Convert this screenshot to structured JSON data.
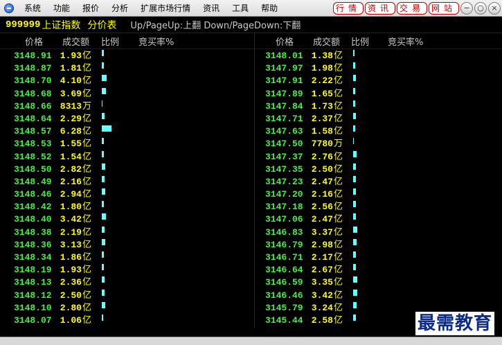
{
  "menu": {
    "items": [
      "系统",
      "功能",
      "报价",
      "分析",
      "扩展市场行情",
      "资讯",
      "工具",
      "帮助"
    ],
    "quick_buttons": [
      "行情",
      "资讯",
      "交易",
      "网站"
    ]
  },
  "header": {
    "code": "999999",
    "name": "上证指数",
    "mode": "分价表",
    "hint": "Up/PageUp:上翻 Down/PageDown:下翻"
  },
  "columns": {
    "price": "价格",
    "volume": "成交额",
    "ratio": "比例",
    "buy_rate": "竞买率%"
  },
  "left_rows": [
    {
      "price": "3148.91",
      "vol": "1.93",
      "unit": "亿",
      "ratio": 0.23
    },
    {
      "price": "3148.87",
      "vol": "1.81",
      "unit": "亿",
      "ratio": 0.22
    },
    {
      "price": "3148.70",
      "vol": "4.10",
      "unit": "亿",
      "ratio": 0.5
    },
    {
      "price": "3148.68",
      "vol": "3.69",
      "unit": "亿",
      "ratio": 0.45
    },
    {
      "price": "3148.66",
      "vol": "8313",
      "unit": "万",
      "ratio": 0.1
    },
    {
      "price": "3148.64",
      "vol": "2.29",
      "unit": "亿",
      "ratio": 0.28
    },
    {
      "price": "3148.57",
      "vol": "6.28",
      "unit": "亿",
      "ratio": 1.0
    },
    {
      "price": "3148.53",
      "vol": "1.55",
      "unit": "亿",
      "ratio": 0.19
    },
    {
      "price": "3148.52",
      "vol": "1.54",
      "unit": "亿",
      "ratio": 0.19
    },
    {
      "price": "3148.50",
      "vol": "2.82",
      "unit": "亿",
      "ratio": 0.34
    },
    {
      "price": "3148.49",
      "vol": "2.16",
      "unit": "亿",
      "ratio": 0.26
    },
    {
      "price": "3148.46",
      "vol": "2.94",
      "unit": "亿",
      "ratio": 0.36
    },
    {
      "price": "3148.42",
      "vol": "1.80",
      "unit": "亿",
      "ratio": 0.22
    },
    {
      "price": "3148.40",
      "vol": "3.42",
      "unit": "亿",
      "ratio": 0.42
    },
    {
      "price": "3148.38",
      "vol": "2.19",
      "unit": "亿",
      "ratio": 0.27
    },
    {
      "price": "3148.36",
      "vol": "3.13",
      "unit": "亿",
      "ratio": 0.38
    },
    {
      "price": "3148.34",
      "vol": "1.86",
      "unit": "亿",
      "ratio": 0.23
    },
    {
      "price": "3148.19",
      "vol": "1.93",
      "unit": "亿",
      "ratio": 0.23
    },
    {
      "price": "3148.13",
      "vol": "2.36",
      "unit": "亿",
      "ratio": 0.29
    },
    {
      "price": "3148.12",
      "vol": "2.50",
      "unit": "亿",
      "ratio": 0.3
    },
    {
      "price": "3148.10",
      "vol": "2.80",
      "unit": "亿",
      "ratio": 0.34
    },
    {
      "price": "3148.07",
      "vol": "1.06",
      "unit": "亿",
      "ratio": 0.13
    }
  ],
  "right_rows": [
    {
      "price": "3148.01",
      "vol": "1.38",
      "unit": "亿",
      "ratio": 0.17
    },
    {
      "price": "3147.97",
      "vol": "1.98",
      "unit": "亿",
      "ratio": 0.24
    },
    {
      "price": "3147.91",
      "vol": "2.22",
      "unit": "亿",
      "ratio": 0.27
    },
    {
      "price": "3147.89",
      "vol": "1.65",
      "unit": "亿",
      "ratio": 0.2
    },
    {
      "price": "3147.84",
      "vol": "1.73",
      "unit": "亿",
      "ratio": 0.21
    },
    {
      "price": "3147.71",
      "vol": "2.37",
      "unit": "亿",
      "ratio": 0.29
    },
    {
      "price": "3147.63",
      "vol": "1.58",
      "unit": "亿",
      "ratio": 0.19
    },
    {
      "price": "3147.50",
      "vol": "7780",
      "unit": "万",
      "ratio": 0.09
    },
    {
      "price": "3147.37",
      "vol": "2.76",
      "unit": "亿",
      "ratio": 0.34
    },
    {
      "price": "3147.35",
      "vol": "2.50",
      "unit": "亿",
      "ratio": 0.3
    },
    {
      "price": "3147.23",
      "vol": "2.47",
      "unit": "亿",
      "ratio": 0.3
    },
    {
      "price": "3147.20",
      "vol": "2.16",
      "unit": "亿",
      "ratio": 0.26
    },
    {
      "price": "3147.18",
      "vol": "2.56",
      "unit": "亿",
      "ratio": 0.31
    },
    {
      "price": "3147.06",
      "vol": "2.47",
      "unit": "亿",
      "ratio": 0.3
    },
    {
      "price": "3146.83",
      "vol": "3.37",
      "unit": "亿",
      "ratio": 0.41
    },
    {
      "price": "3146.79",
      "vol": "2.98",
      "unit": "亿",
      "ratio": 0.36
    },
    {
      "price": "3146.71",
      "vol": "2.17",
      "unit": "亿",
      "ratio": 0.26
    },
    {
      "price": "3146.64",
      "vol": "2.67",
      "unit": "亿",
      "ratio": 0.32
    },
    {
      "price": "3146.59",
      "vol": "3.35",
      "unit": "亿",
      "ratio": 0.41
    },
    {
      "price": "3146.46",
      "vol": "3.42",
      "unit": "亿",
      "ratio": 0.42
    },
    {
      "price": "3145.79",
      "vol": "3.24",
      "unit": "亿",
      "ratio": 0.39
    },
    {
      "price": "3145.44",
      "vol": "2.58",
      "unit": "亿",
      "ratio": 0.31
    }
  ],
  "watermark": "最需教育",
  "colors": {
    "background": "#000000",
    "price": "#44ee44",
    "volume": "#ffff00",
    "bar": "#66ffff",
    "header_text": "#ffff00",
    "separator": "#8a0000",
    "quick_button": "#c00000"
  }
}
